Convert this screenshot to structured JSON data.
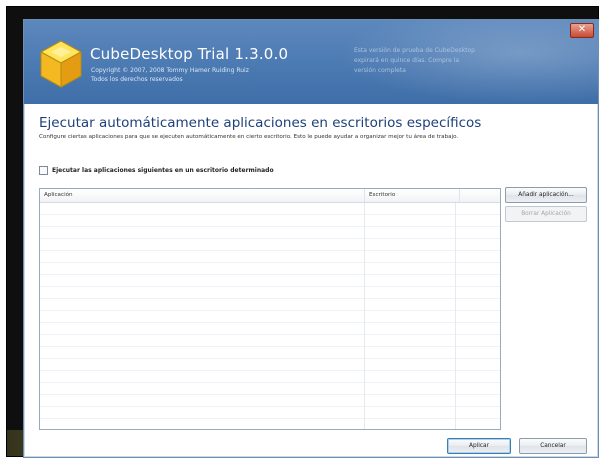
{
  "window": {
    "app_title": "CubeDesktop Trial 1.3.0.0",
    "copyright_line1": "Copyright © 2007, 2008 Tommy Hamer Ruiding Ruiz",
    "copyright_line2": "Todos los derechos reservados",
    "trial_note_line1": "Esta versión de prueba de CubeDesktop",
    "trial_note_line2": "expirará en quince días. Compre la",
    "trial_note_line3": "versión completa",
    "close_glyph": "✕"
  },
  "section": {
    "title": "Ejecutar automáticamente aplicaciones en escritorios específicos",
    "description": "Configure ciertas aplicaciones para que se ejecuten automáticamente en cierto escritorio. Esto le puede ayudar a organizar mejor tu área de trabajo."
  },
  "checkbox": {
    "label": "Ejecutar las aplicaciones siguientes en un escritorio determinado",
    "checked": false
  },
  "list": {
    "columns": [
      "Aplicación",
      "Escritorio",
      ""
    ],
    "rows": []
  },
  "buttons": {
    "add": "Añadir aplicación...",
    "remove": "Borrar Aplicación",
    "apply": "Aplicar",
    "cancel": "Cancelar"
  },
  "colors": {
    "banner": "#4e7cb4",
    "title_blue": "#1e3f7a",
    "close_red": "#c74a33"
  },
  "icons": {
    "app_logo": "yellow-cube-icon",
    "close": "close-icon"
  }
}
